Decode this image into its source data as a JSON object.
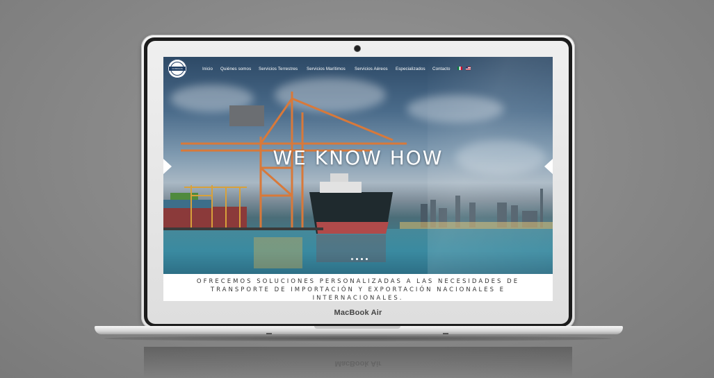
{
  "site": {
    "logo_text": "CONSILOS",
    "nav": {
      "items": [
        {
          "label": "Inicio"
        },
        {
          "label": "Quiénes somos"
        },
        {
          "label": "Servicios Terrestres"
        },
        {
          "label": "Servicios Marítimos"
        },
        {
          "label": "Servicios Aéreos"
        },
        {
          "label": "Especializados"
        },
        {
          "label": "Contacto"
        }
      ],
      "languages": [
        "flag-mexico-icon",
        "flag-usa-icon"
      ]
    },
    "hero": {
      "headline": "WE KNOW HOW",
      "slides_total": 4,
      "active_slide": 1
    },
    "tagline": "OFRECEMOS SOLUCIONES PERSONALIZADAS A LAS NECESIDADES DE TRANSPORTE DE IMPORTACIÓN Y EXPORTACIÓN NACIONALES E INTERNACIONALES."
  },
  "device": {
    "brand": "MacBook Air"
  },
  "colors": {
    "sky_top": "#2d4966",
    "sea": "#3a8aa0",
    "brand_navy": "#1d3c62",
    "crane_orange": "#d8793a",
    "hull_red": "#b04a4a"
  }
}
